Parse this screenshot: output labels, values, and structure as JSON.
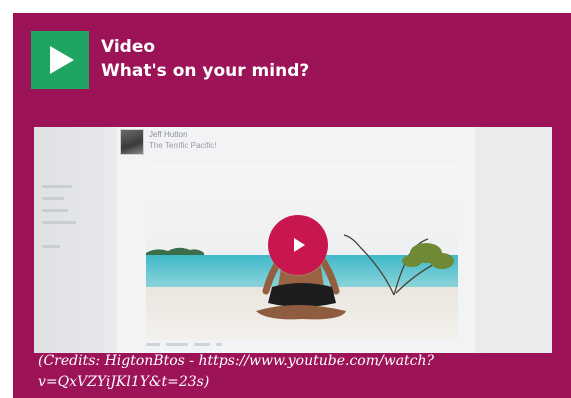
{
  "header": {
    "badge_icon": "play-icon",
    "title": "Video",
    "subtitle": "What's on your mind?"
  },
  "video": {
    "author_name": "Jeff Hutton",
    "author_sub": "The Terrific Pacific!",
    "play_icon": "play-icon"
  },
  "caption": "(Credits: HigtonBtos -  https://www.youtube.com/watch?v=QxVZYiJKl1Y&t=23s)",
  "colors": {
    "card": "#9c1457",
    "badge": "#1fa463",
    "play_button": "#c8174f"
  }
}
